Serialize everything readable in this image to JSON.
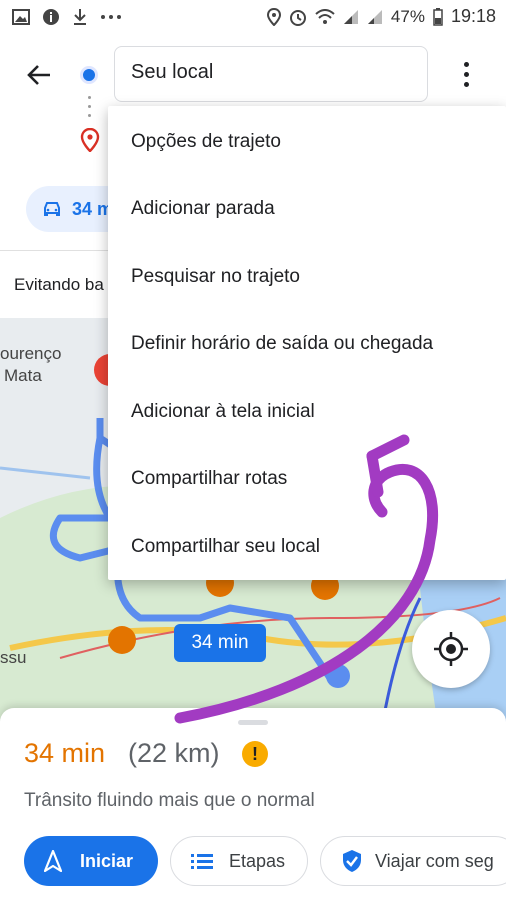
{
  "status_bar": {
    "battery": "47%",
    "time": "19:18",
    "icons": [
      "image-icon",
      "info-icon",
      "download-icon",
      "more-icon",
      "location-icon",
      "alarm-icon",
      "wifi-icon",
      "signal-icon",
      "signal-icon"
    ]
  },
  "header": {
    "origin_value": "Seu local",
    "mode_chip": "34 m",
    "avoid_text": "Evitando ba"
  },
  "menu": {
    "items": [
      "Opções de trajeto",
      "Adicionar parada",
      "Pesquisar no trajeto",
      "Definir horário de saída ou chegada",
      "Adicionar à tela inicial",
      "Compartilhar rotas",
      "Compartilhar seu local"
    ]
  },
  "map": {
    "place_label_1": "ourenço",
    "place_label_2": "Mata",
    "place_label_3": "ssu",
    "route_time_badge": "34 min"
  },
  "sheet": {
    "duration": "34 min",
    "distance": "(22 km)",
    "warning_symbol": "!",
    "traffic_text": "Trânsito fluindo mais que o normal",
    "start_label": "Iniciar",
    "steps_label": "Etapas",
    "travel_label": "Viajar com seg"
  },
  "colors": {
    "accent": "#1a73e8",
    "duration": "#e37400",
    "annotation": "#a23bc2"
  }
}
